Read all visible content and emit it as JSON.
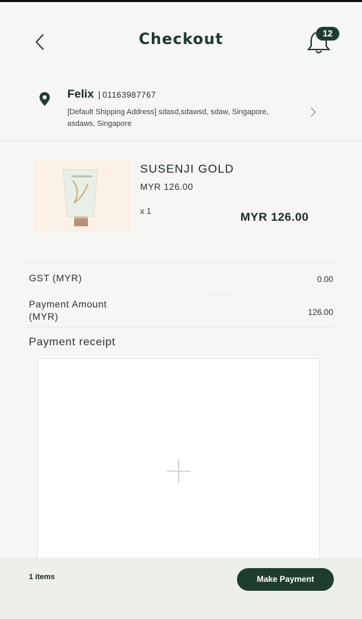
{
  "header": {
    "title": "Checkout",
    "notification_count": "12"
  },
  "address": {
    "name": "Felix",
    "separator": "|",
    "phone": "01163987767",
    "line": "[Default Shipping Address] sdasd,sdawsd, sdaw, Singapore, asdaws, Singapore"
  },
  "product": {
    "name": "SUSENJI GOLD",
    "unit_price": "MYR 126.00",
    "quantity": "x 1",
    "total": "MYR 126.00"
  },
  "summary": {
    "gst_label": "GST (MYR)",
    "gst_value": "0.00",
    "payment_label": "Payment Amount (MYR)",
    "payment_value": "126.00"
  },
  "receipt": {
    "title": "Payment receipt"
  },
  "footer": {
    "items": "1 items",
    "pay_button": "Make Payment"
  },
  "colors": {
    "brand": "#1e3d2f",
    "background": "#f6f7f5",
    "footer": "#ecefea"
  },
  "icons": [
    "back-arrow-icon",
    "bell-icon",
    "location-pin-icon",
    "chevron-right-icon",
    "plus-icon"
  ]
}
